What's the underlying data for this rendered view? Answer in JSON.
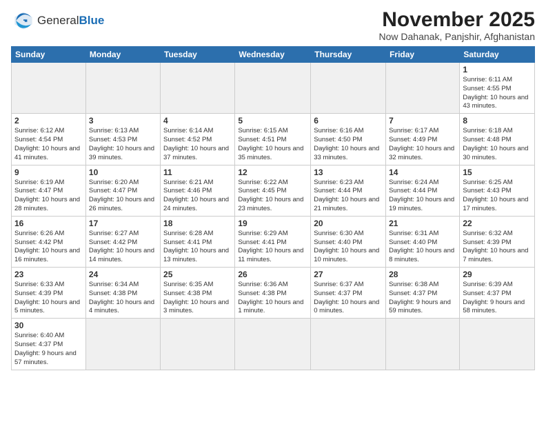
{
  "logo": {
    "text_general": "General",
    "text_blue": "Blue"
  },
  "header": {
    "month_title": "November 2025",
    "location": "Now Dahanak, Panjshir, Afghanistan"
  },
  "weekdays": [
    "Sunday",
    "Monday",
    "Tuesday",
    "Wednesday",
    "Thursday",
    "Friday",
    "Saturday"
  ],
  "weeks": [
    [
      {
        "day": "",
        "info": ""
      },
      {
        "day": "",
        "info": ""
      },
      {
        "day": "",
        "info": ""
      },
      {
        "day": "",
        "info": ""
      },
      {
        "day": "",
        "info": ""
      },
      {
        "day": "",
        "info": ""
      },
      {
        "day": "1",
        "info": "Sunrise: 6:11 AM\nSunset: 4:55 PM\nDaylight: 10 hours and 43 minutes."
      }
    ],
    [
      {
        "day": "2",
        "info": "Sunrise: 6:12 AM\nSunset: 4:54 PM\nDaylight: 10 hours and 41 minutes."
      },
      {
        "day": "3",
        "info": "Sunrise: 6:13 AM\nSunset: 4:53 PM\nDaylight: 10 hours and 39 minutes."
      },
      {
        "day": "4",
        "info": "Sunrise: 6:14 AM\nSunset: 4:52 PM\nDaylight: 10 hours and 37 minutes."
      },
      {
        "day": "5",
        "info": "Sunrise: 6:15 AM\nSunset: 4:51 PM\nDaylight: 10 hours and 35 minutes."
      },
      {
        "day": "6",
        "info": "Sunrise: 6:16 AM\nSunset: 4:50 PM\nDaylight: 10 hours and 33 minutes."
      },
      {
        "day": "7",
        "info": "Sunrise: 6:17 AM\nSunset: 4:49 PM\nDaylight: 10 hours and 32 minutes."
      },
      {
        "day": "8",
        "info": "Sunrise: 6:18 AM\nSunset: 4:48 PM\nDaylight: 10 hours and 30 minutes."
      }
    ],
    [
      {
        "day": "9",
        "info": "Sunrise: 6:19 AM\nSunset: 4:47 PM\nDaylight: 10 hours and 28 minutes."
      },
      {
        "day": "10",
        "info": "Sunrise: 6:20 AM\nSunset: 4:47 PM\nDaylight: 10 hours and 26 minutes."
      },
      {
        "day": "11",
        "info": "Sunrise: 6:21 AM\nSunset: 4:46 PM\nDaylight: 10 hours and 24 minutes."
      },
      {
        "day": "12",
        "info": "Sunrise: 6:22 AM\nSunset: 4:45 PM\nDaylight: 10 hours and 23 minutes."
      },
      {
        "day": "13",
        "info": "Sunrise: 6:23 AM\nSunset: 4:44 PM\nDaylight: 10 hours and 21 minutes."
      },
      {
        "day": "14",
        "info": "Sunrise: 6:24 AM\nSunset: 4:44 PM\nDaylight: 10 hours and 19 minutes."
      },
      {
        "day": "15",
        "info": "Sunrise: 6:25 AM\nSunset: 4:43 PM\nDaylight: 10 hours and 17 minutes."
      }
    ],
    [
      {
        "day": "16",
        "info": "Sunrise: 6:26 AM\nSunset: 4:42 PM\nDaylight: 10 hours and 16 minutes."
      },
      {
        "day": "17",
        "info": "Sunrise: 6:27 AM\nSunset: 4:42 PM\nDaylight: 10 hours and 14 minutes."
      },
      {
        "day": "18",
        "info": "Sunrise: 6:28 AM\nSunset: 4:41 PM\nDaylight: 10 hours and 13 minutes."
      },
      {
        "day": "19",
        "info": "Sunrise: 6:29 AM\nSunset: 4:41 PM\nDaylight: 10 hours and 11 minutes."
      },
      {
        "day": "20",
        "info": "Sunrise: 6:30 AM\nSunset: 4:40 PM\nDaylight: 10 hours and 10 minutes."
      },
      {
        "day": "21",
        "info": "Sunrise: 6:31 AM\nSunset: 4:40 PM\nDaylight: 10 hours and 8 minutes."
      },
      {
        "day": "22",
        "info": "Sunrise: 6:32 AM\nSunset: 4:39 PM\nDaylight: 10 hours and 7 minutes."
      }
    ],
    [
      {
        "day": "23",
        "info": "Sunrise: 6:33 AM\nSunset: 4:39 PM\nDaylight: 10 hours and 5 minutes."
      },
      {
        "day": "24",
        "info": "Sunrise: 6:34 AM\nSunset: 4:38 PM\nDaylight: 10 hours and 4 minutes."
      },
      {
        "day": "25",
        "info": "Sunrise: 6:35 AM\nSunset: 4:38 PM\nDaylight: 10 hours and 3 minutes."
      },
      {
        "day": "26",
        "info": "Sunrise: 6:36 AM\nSunset: 4:38 PM\nDaylight: 10 hours and 1 minute."
      },
      {
        "day": "27",
        "info": "Sunrise: 6:37 AM\nSunset: 4:37 PM\nDaylight: 10 hours and 0 minutes."
      },
      {
        "day": "28",
        "info": "Sunrise: 6:38 AM\nSunset: 4:37 PM\nDaylight: 9 hours and 59 minutes."
      },
      {
        "day": "29",
        "info": "Sunrise: 6:39 AM\nSunset: 4:37 PM\nDaylight: 9 hours and 58 minutes."
      }
    ],
    [
      {
        "day": "30",
        "info": "Sunrise: 6:40 AM\nSunset: 4:37 PM\nDaylight: 9 hours and 57 minutes."
      },
      {
        "day": "",
        "info": ""
      },
      {
        "day": "",
        "info": ""
      },
      {
        "day": "",
        "info": ""
      },
      {
        "day": "",
        "info": ""
      },
      {
        "day": "",
        "info": ""
      },
      {
        "day": "",
        "info": ""
      }
    ]
  ]
}
